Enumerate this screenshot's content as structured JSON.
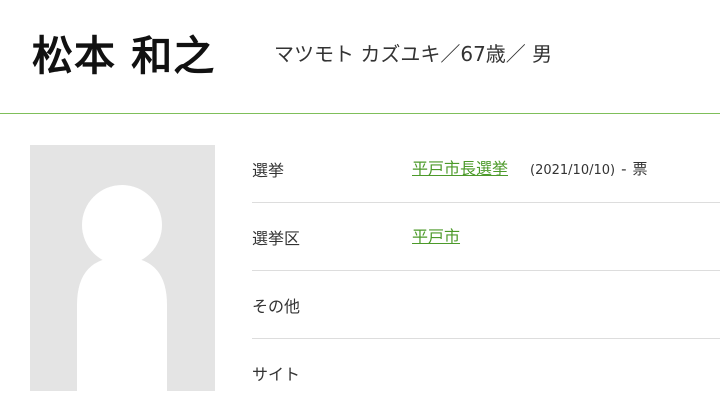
{
  "candidate": {
    "name": "松本 和之",
    "subinfo": "マツモト カズユキ／67歳／ 男"
  },
  "photo": {
    "icon": "person-placeholder-icon"
  },
  "details": {
    "election": {
      "label": "選挙",
      "link": "平戸市長選挙",
      "date": "(2021/10/10)",
      "dash": "-",
      "votes": "票"
    },
    "district": {
      "label": "選挙区",
      "link": "平戸市"
    },
    "other": {
      "label": "その他",
      "value": ""
    },
    "site": {
      "label": "サイト",
      "value": ""
    }
  },
  "colors": {
    "accent": "#4c9a2a",
    "divider": "#7fbf5a",
    "photo_bg": "#e4e4e4"
  }
}
